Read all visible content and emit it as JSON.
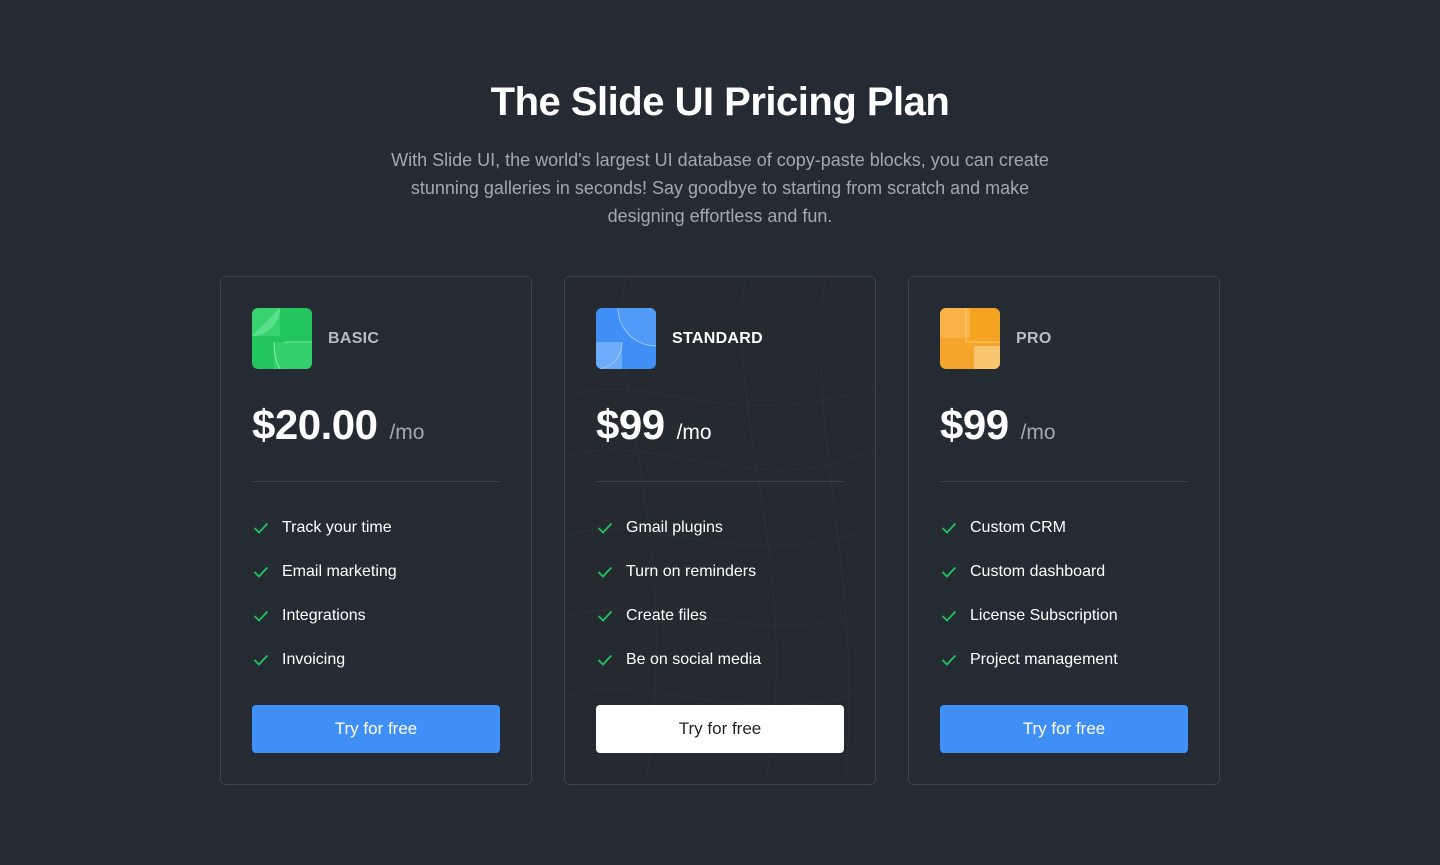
{
  "header": {
    "title": "The Slide UI Pricing Plan",
    "subtitle": "With Slide UI, the world's largest UI database of copy-paste blocks, you can create stunning galleries in seconds! Say goodbye to starting from scratch and make designing effortless and fun."
  },
  "plans": [
    {
      "name": "BASIC",
      "price": "$20.00",
      "period": "/mo",
      "logo_color": "#22c55e",
      "logo_icon": "basic-plan-logo-icon",
      "features": [
        "Track your time",
        "Email marketing",
        "Integrations",
        "Invoicing"
      ],
      "cta": "Try for free",
      "cta_style": "primary"
    },
    {
      "name": "STANDARD",
      "price": "$99",
      "period": "/mo",
      "logo_color": "#3f8ff7",
      "logo_icon": "standard-plan-logo-icon",
      "features": [
        "Gmail plugins",
        "Turn on reminders",
        "Create files",
        "Be on social media"
      ],
      "cta": "Try for free",
      "cta_style": "light"
    },
    {
      "name": "PRO",
      "price": "$99",
      "period": "/mo",
      "logo_color": "#f5a52b",
      "logo_icon": "pro-plan-logo-icon",
      "features": [
        "Custom CRM",
        "Custom dashboard",
        "License Subscription",
        "Project management"
      ],
      "cta": "Try for free",
      "cta_style": "primary"
    }
  ],
  "colors": {
    "background": "#252b32",
    "accent": "#3f8ff7",
    "check": "#22c55e"
  }
}
